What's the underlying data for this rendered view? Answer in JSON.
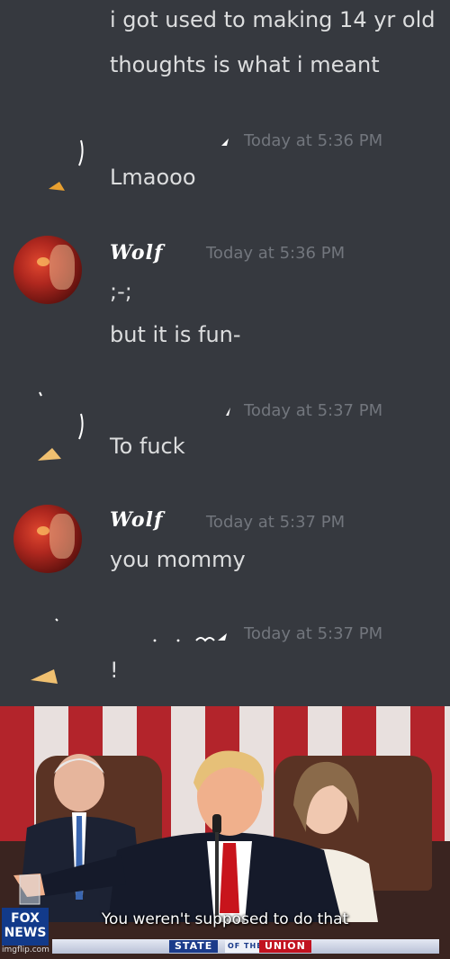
{
  "messages": [
    {
      "lines": [
        "i got used to making 14 yr old",
        "thoughts is what i meant"
      ]
    },
    {
      "timestamp": "Today at 5:36 PM",
      "lines": [
        "Lmaooo"
      ]
    },
    {
      "author": "Wolf",
      "timestamp": "Today at 5:36 PM",
      "lines": [
        ";-;",
        "but it is fun-"
      ]
    },
    {
      "timestamp": "Today at 5:37 PM",
      "lines": [
        "To fuck"
      ]
    },
    {
      "author": "Wolf",
      "timestamp": "Today at 5:37 PM",
      "lines": [
        "you mommy"
      ]
    },
    {
      "timestamp": "Today at 5:37 PM",
      "lines": [
        "!"
      ]
    }
  ],
  "meme": {
    "caption": "You weren't supposed to do that",
    "network_logo": "FOX NEWS",
    "banner_left": "STATE",
    "banner_mid": "OF THE",
    "banner_right": "UNION",
    "watermark": "imgflip.com"
  },
  "colors": {
    "chat_bg": "#36393f",
    "text": "#dcddde",
    "timestamp": "#72767d"
  }
}
